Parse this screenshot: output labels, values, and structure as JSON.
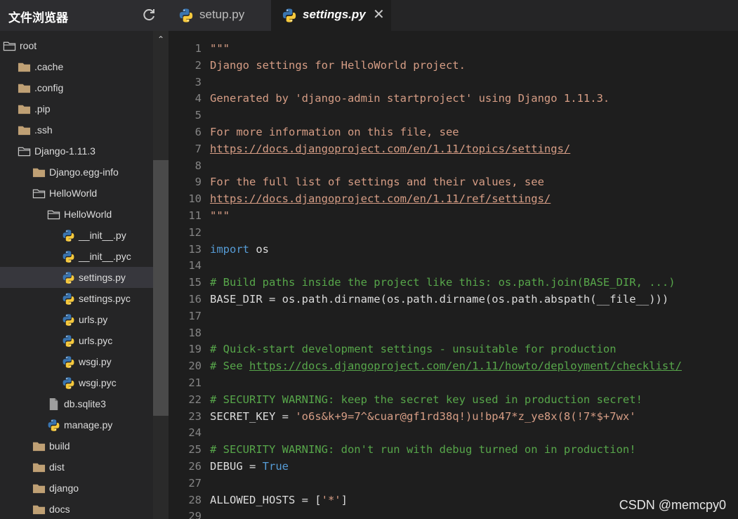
{
  "sidebar": {
    "title": "文件浏览器",
    "refresh_icon": "refresh-icon",
    "tree": [
      {
        "label": "root",
        "type": "folder-open",
        "depth": 0
      },
      {
        "label": ".cache",
        "type": "folder",
        "depth": 1
      },
      {
        "label": ".config",
        "type": "folder",
        "depth": 1
      },
      {
        "label": ".pip",
        "type": "folder",
        "depth": 1
      },
      {
        "label": ".ssh",
        "type": "folder",
        "depth": 1
      },
      {
        "label": "Django-1.11.3",
        "type": "folder-open",
        "depth": 1
      },
      {
        "label": "Django.egg-info",
        "type": "folder",
        "depth": 2
      },
      {
        "label": "HelloWorld",
        "type": "folder-open",
        "depth": 2
      },
      {
        "label": "HelloWorld",
        "type": "folder-open",
        "depth": 3
      },
      {
        "label": "__init__.py",
        "type": "python",
        "depth": 4
      },
      {
        "label": "__init__.pyc",
        "type": "python",
        "depth": 4
      },
      {
        "label": "settings.py",
        "type": "python",
        "depth": 4,
        "selected": true
      },
      {
        "label": "settings.pyc",
        "type": "python",
        "depth": 4
      },
      {
        "label": "urls.py",
        "type": "python",
        "depth": 4
      },
      {
        "label": "urls.pyc",
        "type": "python",
        "depth": 4
      },
      {
        "label": "wsgi.py",
        "type": "python",
        "depth": 4
      },
      {
        "label": "wsgi.pyc",
        "type": "python",
        "depth": 4
      },
      {
        "label": "db.sqlite3",
        "type": "file",
        "depth": 3
      },
      {
        "label": "manage.py",
        "type": "python",
        "depth": 3
      },
      {
        "label": "build",
        "type": "folder",
        "depth": 2
      },
      {
        "label": "dist",
        "type": "folder",
        "depth": 2
      },
      {
        "label": "django",
        "type": "folder",
        "depth": 2
      },
      {
        "label": "docs",
        "type": "folder",
        "depth": 2
      }
    ]
  },
  "tabs": [
    {
      "label": "setup.py",
      "icon": "python-icon",
      "active": false
    },
    {
      "label": "settings.py",
      "icon": "python-icon",
      "active": true,
      "close": "✕"
    }
  ],
  "editor": {
    "lines": [
      {
        "n": "1",
        "parts": [
          {
            "t": "\"\"\"",
            "c": "doc"
          }
        ]
      },
      {
        "n": "2",
        "parts": [
          {
            "t": "Django settings for HelloWorld project.",
            "c": "doc"
          }
        ]
      },
      {
        "n": "3",
        "parts": []
      },
      {
        "n": "4",
        "parts": [
          {
            "t": "Generated by 'django-admin startproject' using Django 1.11.3.",
            "c": "doc"
          }
        ]
      },
      {
        "n": "5",
        "parts": []
      },
      {
        "n": "6",
        "parts": [
          {
            "t": "For more information on this file, see",
            "c": "doc"
          }
        ]
      },
      {
        "n": "7",
        "parts": [
          {
            "t": "https://docs.djangoproject.com/en/1.11/topics/settings/",
            "c": "doc u"
          }
        ]
      },
      {
        "n": "8",
        "parts": []
      },
      {
        "n": "9",
        "parts": [
          {
            "t": "For the full list of settings and their values, see",
            "c": "doc"
          }
        ]
      },
      {
        "n": "10",
        "parts": [
          {
            "t": "https://docs.djangoproject.com/en/1.11/ref/settings/",
            "c": "doc u"
          }
        ]
      },
      {
        "n": "11",
        "parts": [
          {
            "t": "\"\"\"",
            "c": "doc"
          }
        ]
      },
      {
        "n": "12",
        "parts": []
      },
      {
        "n": "13",
        "parts": [
          {
            "t": "import",
            "c": "kw"
          },
          {
            "t": " os",
            "c": "plain"
          }
        ]
      },
      {
        "n": "14",
        "parts": []
      },
      {
        "n": "15",
        "parts": [
          {
            "t": "# Build paths inside the project like this: os.path.join(BASE_DIR, ...)",
            "c": "cm"
          }
        ]
      },
      {
        "n": "16",
        "parts": [
          {
            "t": "BASE_DIR = os.path.dirname(os.path.dirname(os.path.abspath(__file__)))",
            "c": "plain"
          }
        ]
      },
      {
        "n": "17",
        "parts": []
      },
      {
        "n": "18",
        "parts": []
      },
      {
        "n": "19",
        "parts": [
          {
            "t": "# Quick-start development settings - unsuitable for production",
            "c": "cm"
          }
        ]
      },
      {
        "n": "20",
        "parts": [
          {
            "t": "# See ",
            "c": "cm"
          },
          {
            "t": "https://docs.djangoproject.com/en/1.11/howto/deployment/checklist/",
            "c": "cm u"
          }
        ]
      },
      {
        "n": "21",
        "parts": []
      },
      {
        "n": "22",
        "parts": [
          {
            "t": "# SECURITY WARNING: keep the secret key used in production secret!",
            "c": "cm"
          }
        ]
      },
      {
        "n": "23",
        "parts": [
          {
            "t": "SECRET_KEY = ",
            "c": "plain"
          },
          {
            "t": "'o6s&k+9=7^&cuar@gf1rd38q!)u!bp47*z_ye8x(8(!7*$+7wx'",
            "c": "str"
          }
        ]
      },
      {
        "n": "24",
        "parts": []
      },
      {
        "n": "25",
        "parts": [
          {
            "t": "# SECURITY WARNING: don't run with debug turned on in production!",
            "c": "cm"
          }
        ]
      },
      {
        "n": "26",
        "parts": [
          {
            "t": "DEBUG = ",
            "c": "plain"
          },
          {
            "t": "True",
            "c": "kw"
          }
        ]
      },
      {
        "n": "27",
        "parts": []
      },
      {
        "n": "28",
        "parts": [
          {
            "t": "ALLOWED_HOSTS = [",
            "c": "plain"
          },
          {
            "t": "'*'",
            "c": "str"
          },
          {
            "t": "]",
            "c": "plain"
          }
        ]
      },
      {
        "n": "29",
        "parts": []
      }
    ]
  },
  "watermark": "CSDN @memcpy0"
}
